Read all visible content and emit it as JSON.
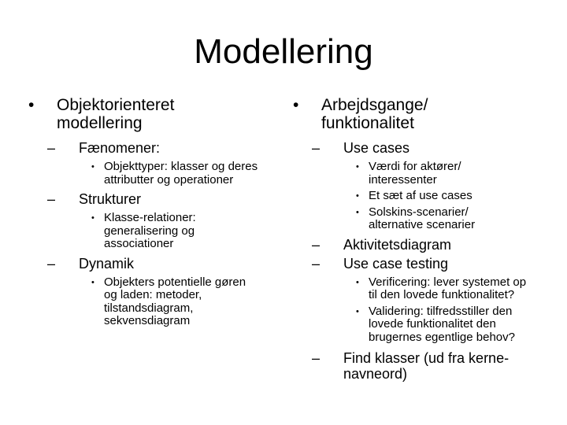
{
  "title": "Modellering",
  "left": {
    "heading": "Objektorienteret modellering",
    "sections": [
      {
        "label": "Fænomener:",
        "items": [
          "Objekttyper: klasser og deres attributter og operationer"
        ]
      },
      {
        "label": "Strukturer",
        "items": [
          "Klasse-relationer: generalisering og associationer"
        ]
      },
      {
        "label": "Dynamik",
        "items": [
          "Objekters potentielle gøren og laden: metoder, tilstandsdiagram, sekvensdiagram"
        ]
      }
    ]
  },
  "right": {
    "heading": "Arbejdsgange/ funktionalitet",
    "sections": [
      {
        "label": "Use cases",
        "items": [
          "Værdi for aktører/ interessenter",
          "Et sæt af use cases",
          "Solskins-scenarier/ alternative scenarier"
        ]
      },
      {
        "label": "Aktivitetsdiagram",
        "items": []
      },
      {
        "label": "Use case testing",
        "items": [
          "Verificering: lever systemet op til den lovede funktionalitet?",
          "Validering: tilfredsstiller den lovede funktionalitet den brugernes egentlige behov?"
        ]
      },
      {
        "label": "Find klasser (ud fra kerne-navneord)",
        "items": []
      }
    ]
  },
  "markers": {
    "bullet": "•",
    "dash": "–"
  }
}
